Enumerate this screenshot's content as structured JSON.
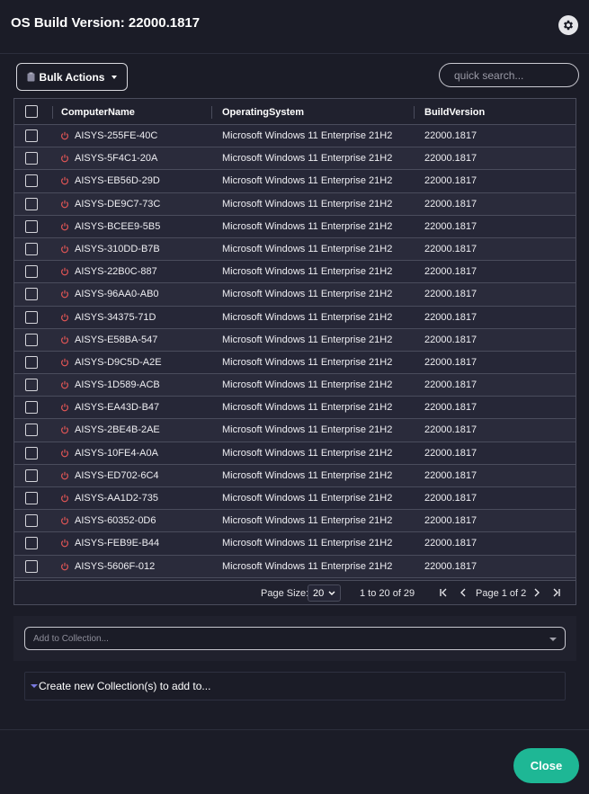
{
  "header": {
    "title": "OS Build Version: 22000.1817",
    "settings_icon": "gear-icon"
  },
  "toolbar": {
    "bulk_actions_label": "Bulk Actions",
    "bulk_icon": "clipboard-icon",
    "search_placeholder": "quick search..."
  },
  "grid": {
    "columns": [
      "ComputerName",
      "OperatingSystem",
      "BuildVersion"
    ],
    "row_icon": "power-icon",
    "rows": [
      {
        "name": "AISYS-255FE-40C",
        "os": "Microsoft Windows 11 Enterprise 21H2",
        "build": "22000.1817"
      },
      {
        "name": "AISYS-5F4C1-20A",
        "os": "Microsoft Windows 11 Enterprise 21H2",
        "build": "22000.1817"
      },
      {
        "name": "AISYS-EB56D-29D",
        "os": "Microsoft Windows 11 Enterprise 21H2",
        "build": "22000.1817"
      },
      {
        "name": "AISYS-DE9C7-73C",
        "os": "Microsoft Windows 11 Enterprise 21H2",
        "build": "22000.1817"
      },
      {
        "name": "AISYS-BCEE9-5B5",
        "os": "Microsoft Windows 11 Enterprise 21H2",
        "build": "22000.1817"
      },
      {
        "name": "AISYS-310DD-B7B",
        "os": "Microsoft Windows 11 Enterprise 21H2",
        "build": "22000.1817"
      },
      {
        "name": "AISYS-22B0C-887",
        "os": "Microsoft Windows 11 Enterprise 21H2",
        "build": "22000.1817"
      },
      {
        "name": "AISYS-96AA0-AB0",
        "os": "Microsoft Windows 11 Enterprise 21H2",
        "build": "22000.1817"
      },
      {
        "name": "AISYS-34375-71D",
        "os": "Microsoft Windows 11 Enterprise 21H2",
        "build": "22000.1817"
      },
      {
        "name": "AISYS-E58BA-547",
        "os": "Microsoft Windows 11 Enterprise 21H2",
        "build": "22000.1817"
      },
      {
        "name": "AISYS-D9C5D-A2E",
        "os": "Microsoft Windows 11 Enterprise 21H2",
        "build": "22000.1817"
      },
      {
        "name": "AISYS-1D589-ACB",
        "os": "Microsoft Windows 11 Enterprise 21H2",
        "build": "22000.1817"
      },
      {
        "name": "AISYS-EA43D-B47",
        "os": "Microsoft Windows 11 Enterprise 21H2",
        "build": "22000.1817"
      },
      {
        "name": "AISYS-2BE4B-2AE",
        "os": "Microsoft Windows 11 Enterprise 21H2",
        "build": "22000.1817"
      },
      {
        "name": "AISYS-10FE4-A0A",
        "os": "Microsoft Windows 11 Enterprise 21H2",
        "build": "22000.1817"
      },
      {
        "name": "AISYS-ED702-6C4",
        "os": "Microsoft Windows 11 Enterprise 21H2",
        "build": "22000.1817"
      },
      {
        "name": "AISYS-AA1D2-735",
        "os": "Microsoft Windows 11 Enterprise 21H2",
        "build": "22000.1817"
      },
      {
        "name": "AISYS-60352-0D6",
        "os": "Microsoft Windows 11 Enterprise 21H2",
        "build": "22000.1817"
      },
      {
        "name": "AISYS-FEB9E-B44",
        "os": "Microsoft Windows 11 Enterprise 21H2",
        "build": "22000.1817"
      },
      {
        "name": "AISYS-5606F-012",
        "os": "Microsoft Windows 11 Enterprise 21H2",
        "build": "22000.1817"
      }
    ]
  },
  "pager": {
    "page_size_label": "Page Size:",
    "page_size_value": "20",
    "range_text": "1 to 20 of 29",
    "page_label": "Page 1 of 2"
  },
  "collection": {
    "placeholder": "Add to Collection...",
    "create_label": "Create new Collection(s) to add to..."
  },
  "footer": {
    "close_label": "Close"
  },
  "colors": {
    "background": "#1b1c27",
    "accent": "#1eb795",
    "power_icon": "#e05555"
  }
}
